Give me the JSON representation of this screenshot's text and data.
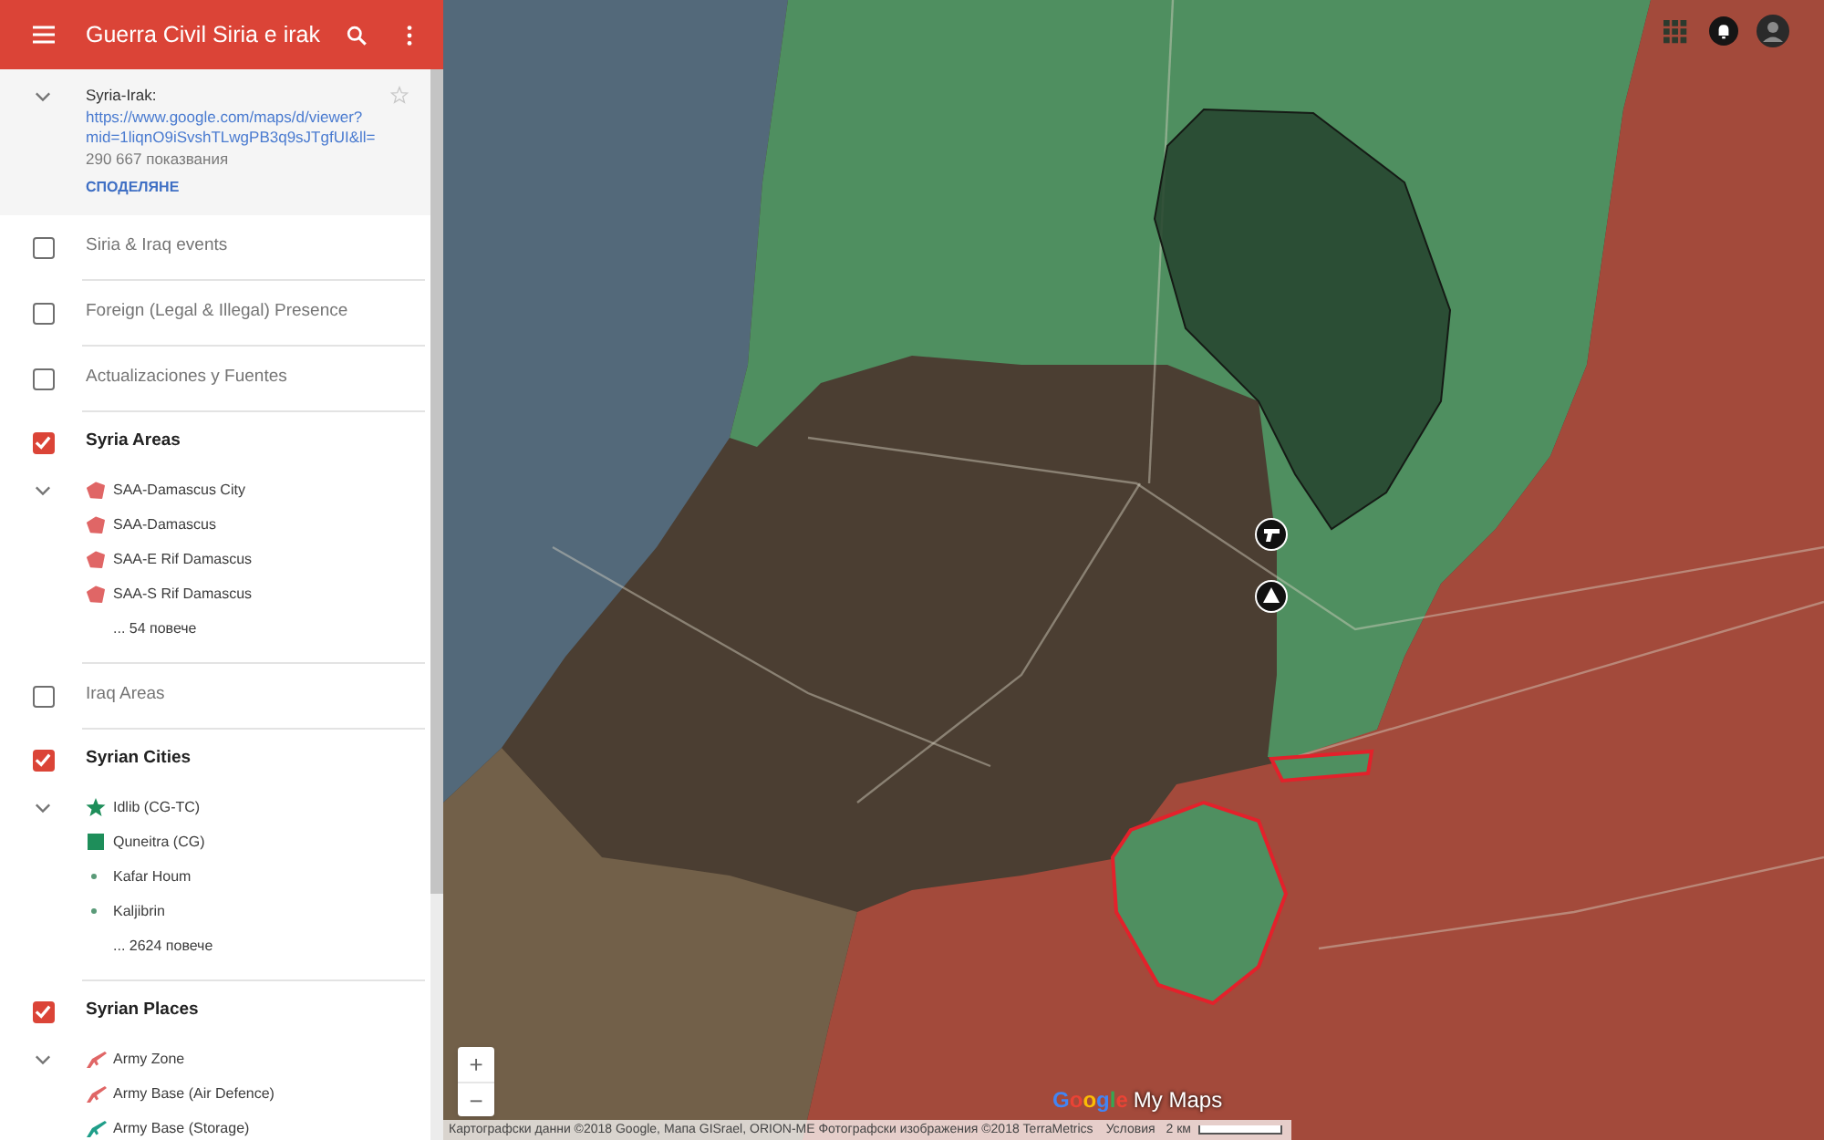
{
  "header": {
    "title": "Guerra Civil Siria e irak"
  },
  "map_info": {
    "name": "Syria-Irak:",
    "url_lines": [
      "https://www.google.com/maps/d/viewer?",
      "mid=1liqnO9iSvshTLwgPB3q9sJTgfUI&ll="
    ],
    "views": "290 667 показвания",
    "share": "СПОДЕЛЯНЕ"
  },
  "layers": [
    {
      "name": "Siria & Iraq events",
      "checked": false
    },
    {
      "name": "Foreign (Legal & Illegal) Presence",
      "checked": false
    },
    {
      "name": "Actualizaciones y Fuentes",
      "checked": false
    },
    {
      "name": "Syria Areas",
      "checked": true,
      "items": [
        {
          "label": "SAA-Damascus City",
          "kind": "polygon",
          "color": "#e06666"
        },
        {
          "label": "SAA-Damascus",
          "kind": "polygon",
          "color": "#e06666"
        },
        {
          "label": "SAA-E Rif Damascus",
          "kind": "polygon",
          "color": "#e06666"
        },
        {
          "label": "SAA-S Rif Damascus",
          "kind": "polygon",
          "color": "#e06666"
        }
      ],
      "more": "... 54 повече"
    },
    {
      "name": "Iraq Areas",
      "checked": false
    },
    {
      "name": "Syrian Cities",
      "checked": true,
      "items": [
        {
          "label": "Idlib (CG-TC)",
          "kind": "star",
          "color": "#1e8e5a"
        },
        {
          "label": "Quneitra (CG)",
          "kind": "square",
          "color": "#1e8e5a"
        },
        {
          "label": "Kafar Houm",
          "kind": "dot",
          "color": "#5a9a78"
        },
        {
          "label": "Kaljibrin",
          "kind": "dot",
          "color": "#5a9a78"
        }
      ],
      "more": "... 2624 повече"
    },
    {
      "name": "Syrian Places",
      "checked": true,
      "items": [
        {
          "label": "Army Zone",
          "kind": "rifle",
          "color": "#e06666"
        },
        {
          "label": "Army Base (Air Defence)",
          "kind": "rifle",
          "color": "#e06666"
        },
        {
          "label": "Army Base (Storage)",
          "kind": "rifle",
          "color": "#1f9e89"
        }
      ]
    }
  ],
  "map": {
    "zoom_controls": [
      "+",
      "−"
    ],
    "logo": {
      "brand": "Google",
      "product": "My Maps"
    },
    "attribution": {
      "data": "Картографски данни ©2018 Google, Мапа GISrael, ORION-ME Фотографски изображения ©2018 TerraMetrics",
      "terms": "Условия",
      "scale": "2 км"
    }
  }
}
